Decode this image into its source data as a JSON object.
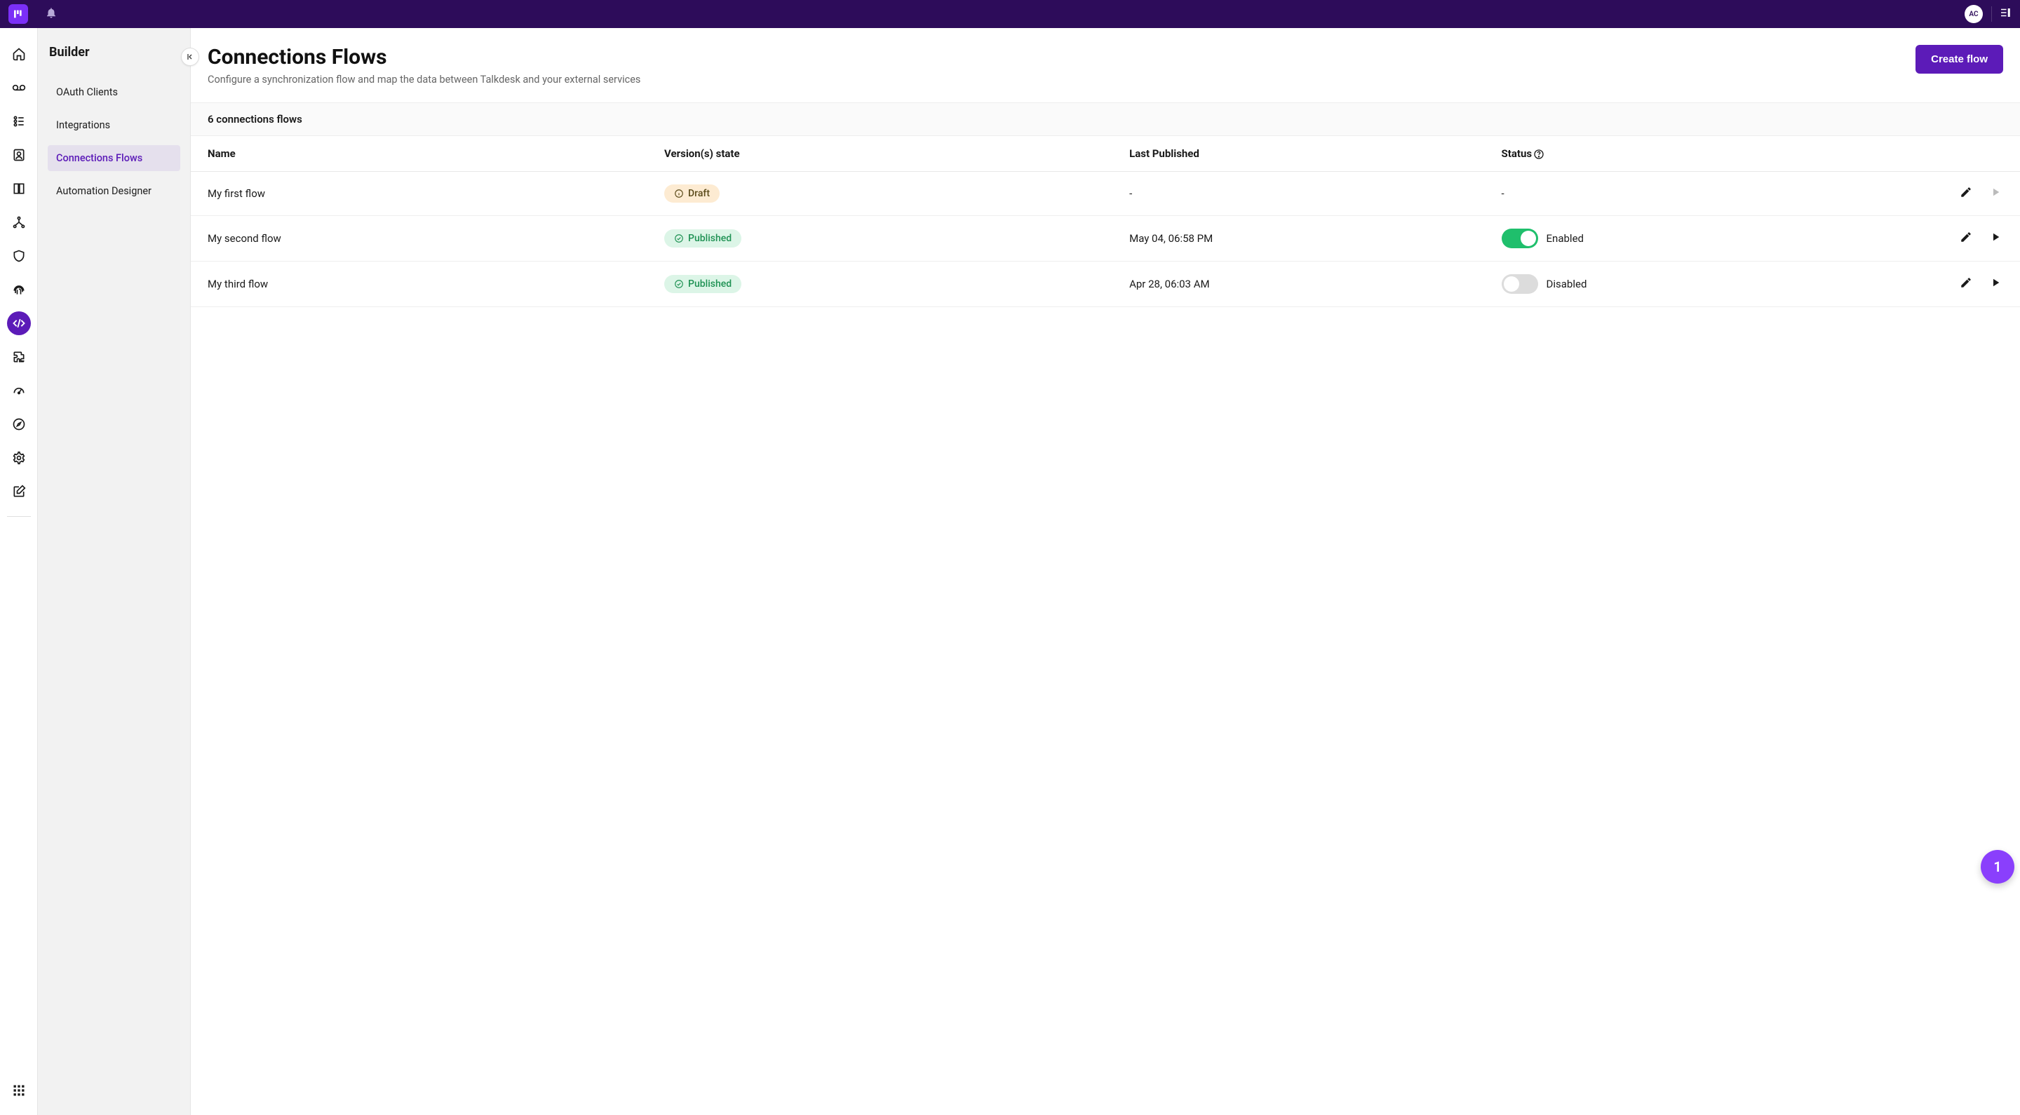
{
  "header": {
    "avatar": "AC"
  },
  "sidebar": {
    "title": "Builder",
    "items": [
      {
        "label": "OAuth Clients",
        "active": false
      },
      {
        "label": "Integrations",
        "active": false
      },
      {
        "label": "Connections Flows",
        "active": true
      },
      {
        "label": "Automation Designer",
        "active": false
      }
    ]
  },
  "page": {
    "title": "Connections Flows",
    "subtitle": "Configure a synchronization flow and map the data between Talkdesk and your external services",
    "create_button": "Create flow"
  },
  "table": {
    "count_label": "6 connections flows",
    "columns": {
      "name": "Name",
      "state": "Version(s) state",
      "published": "Last Published",
      "status": "Status"
    },
    "rows": [
      {
        "name": "My first flow",
        "state": "Draft",
        "state_type": "draft",
        "published": "-",
        "status_text": "-",
        "status_type": "none"
      },
      {
        "name": "My second flow",
        "state": "Published",
        "state_type": "published",
        "published": "May 04, 06:58 PM",
        "status_text": "Enabled",
        "status_type": "enabled"
      },
      {
        "name": "My third flow",
        "state": "Published",
        "state_type": "published",
        "published": "Apr 28, 06:03 AM",
        "status_text": "Disabled",
        "status_type": "disabled"
      }
    ]
  },
  "fab": {
    "label": "1"
  },
  "rail_icons": [
    "home-icon",
    "voicemail-icon",
    "queue-icon",
    "contacts-icon",
    "book-icon",
    "route-icon",
    "shield-icon",
    "fingerprint-icon",
    "code-icon",
    "puzzle-icon",
    "gauge-icon",
    "compass-icon",
    "gear-icon",
    "edit-icon"
  ],
  "rail_active_index": 8,
  "colors": {
    "brand": "#5c1bb8",
    "topbar": "#2d0c5a",
    "logo": "#7b2ff7",
    "enabled": "#1fbf6c",
    "fab": "#8a3ffc"
  }
}
